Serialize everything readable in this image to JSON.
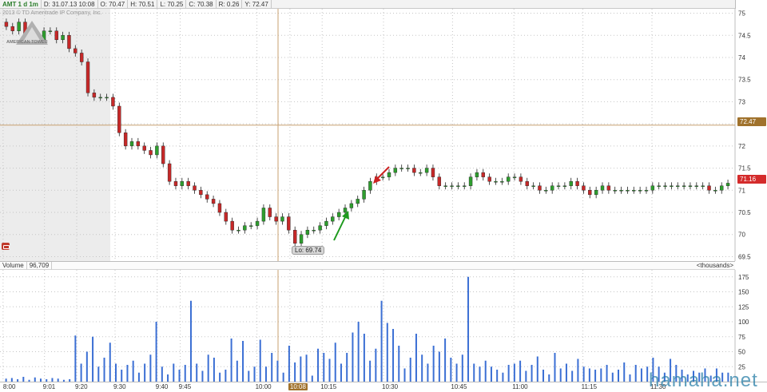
{
  "header": {
    "symbol": "AMT 1 d 1m",
    "date": "D: 31.07.13 10:08",
    "open": "O: 70.47",
    "high": "H: 70.51",
    "low": "L: 70.25",
    "close": "C: 70.38",
    "range": "R: 0.26",
    "y": "Y: 72.47"
  },
  "copyright": "2013 © TD Ameritrade IP Company, Inc.",
  "logo_text": "AMERICAN TOWER",
  "low_marker": "Lo: 69.74",
  "cursor_price": "72.47",
  "last_price": "71.16",
  "volume_header": {
    "label": "Volume",
    "value": "96,709",
    "units": "<thousands>"
  },
  "watermark": "hamaha.net",
  "icons": {
    "alert": "phone-icon",
    "up_arrow": "green-arrow-icon",
    "down_arrow": "red-arrow-icon"
  },
  "colors": {
    "up": "#2e9e2e",
    "down": "#c62828",
    "volume": "#3b6fd4",
    "cursor": "#a0722c",
    "crosshair": "#c8a070"
  },
  "chart_data": [
    {
      "type": "candlestick",
      "ylim": [
        69.4,
        75.1
      ],
      "y_ticks": [
        "75",
        "74.5",
        "74",
        "73.5",
        "73",
        "72.5",
        "72",
        "71.5",
        "71",
        "70.5",
        "70",
        "69.5"
      ],
      "x_ticks": [
        "8:00",
        "9:01",
        "9:20",
        "9:30",
        "9:40",
        "9:45",
        "10:00",
        "10:08",
        "10:15",
        "10:30",
        "10:45",
        "11:00",
        "11:15",
        "11:30"
      ],
      "close": [
        74.7,
        74.6,
        74.8,
        74.5,
        74.5,
        74.4,
        74.6,
        74.6,
        74.4,
        74.5,
        74.2,
        74.1,
        73.9,
        73.2,
        73.1,
        73.1,
        73.1,
        72.9,
        72.3,
        72.0,
        72.1,
        72.0,
        71.9,
        71.8,
        72.0,
        71.6,
        71.2,
        71.1,
        71.2,
        71.1,
        71.0,
        70.9,
        70.8,
        70.7,
        70.5,
        70.3,
        70.1,
        70.1,
        70.2,
        70.2,
        70.3,
        70.6,
        70.4,
        70.3,
        70.4,
        70.1,
        69.8,
        70.0,
        70.1,
        70.1,
        70.2,
        70.3,
        70.4,
        70.5,
        70.6,
        70.7,
        70.8,
        71.0,
        71.2,
        71.3,
        71.3,
        71.4,
        71.5,
        71.5,
        71.5,
        71.4,
        71.4,
        71.5,
        71.3,
        71.1,
        71.1,
        71.1,
        71.1,
        71.1,
        71.3,
        71.4,
        71.3,
        71.2,
        71.2,
        71.2,
        71.3,
        71.3,
        71.2,
        71.1,
        71.1,
        71.0,
        71.0,
        71.1,
        71.1,
        71.1,
        71.2,
        71.1,
        71.0,
        70.9,
        71.0,
        71.1,
        71.0,
        71.0,
        71.0,
        71.0,
        71.0,
        71.0,
        71.0,
        71.1,
        71.1,
        71.1,
        71.1,
        71.1,
        71.1,
        71.1,
        71.1,
        71.1,
        71.0,
        71.0,
        71.1,
        71.16
      ],
      "open": [
        74.8,
        74.7,
        74.6,
        74.8,
        74.5,
        74.5,
        74.4,
        74.6,
        74.6,
        74.4,
        74.5,
        74.2,
        74.1,
        73.9,
        73.2,
        73.1,
        73.1,
        73.1,
        72.9,
        72.3,
        72.0,
        72.1,
        72.0,
        71.9,
        71.8,
        72.0,
        71.6,
        71.2,
        71.1,
        71.2,
        71.1,
        71.0,
        70.9,
        70.8,
        70.7,
        70.5,
        70.3,
        70.1,
        70.1,
        70.2,
        70.2,
        70.3,
        70.6,
        70.4,
        70.3,
        70.4,
        70.1,
        69.8,
        70.0,
        70.1,
        70.1,
        70.2,
        70.3,
        70.4,
        70.5,
        70.6,
        70.7,
        70.8,
        71.0,
        71.2,
        71.3,
        71.3,
        71.4,
        71.5,
        71.5,
        71.5,
        71.4,
        71.4,
        71.5,
        71.3,
        71.1,
        71.1,
        71.1,
        71.1,
        71.1,
        71.3,
        71.4,
        71.3,
        71.2,
        71.2,
        71.2,
        71.3,
        71.3,
        71.2,
        71.1,
        71.1,
        71.0,
        71.0,
        71.1,
        71.1,
        71.1,
        71.2,
        71.1,
        71.0,
        70.9,
        71.0,
        71.1,
        71.0,
        71.0,
        71.0,
        71.0,
        71.0,
        71.0,
        71.0,
        71.1,
        71.1,
        71.1,
        71.1,
        71.1,
        71.1,
        71.1,
        71.1,
        71.1,
        71.0,
        71.0,
        71.1
      ]
    },
    {
      "type": "bar",
      "ylim": [
        0,
        180
      ],
      "y_ticks": [
        "175",
        "150",
        "125",
        "100",
        "75",
        "50",
        "25"
      ],
      "values": [
        5,
        6,
        4,
        8,
        3,
        7,
        5,
        4,
        6,
        5,
        3,
        4,
        77,
        30,
        50,
        75,
        25,
        40,
        65,
        30,
        20,
        28,
        35,
        15,
        30,
        45,
        100,
        25,
        12,
        30,
        20,
        28,
        135,
        30,
        18,
        45,
        40,
        15,
        20,
        72,
        35,
        68,
        18,
        25,
        70,
        25,
        48,
        35,
        15,
        60,
        32,
        42,
        45,
        10,
        55,
        48,
        38,
        65,
        30,
        48,
        82,
        100,
        80,
        35,
        55,
        135,
        98,
        88,
        60,
        22,
        40,
        80,
        45,
        30,
        60,
        50,
        72,
        40,
        30,
        45,
        175,
        30,
        25,
        35,
        25,
        20,
        15,
        28,
        30,
        35,
        18,
        28,
        42,
        20,
        12,
        48,
        22,
        30,
        18,
        38,
        25,
        22,
        20,
        22,
        28,
        15,
        20,
        32,
        12,
        28,
        22,
        25,
        40,
        25,
        15,
        38,
        28,
        20,
        12,
        18,
        15,
        22,
        10,
        22,
        15,
        15
      ]
    }
  ]
}
